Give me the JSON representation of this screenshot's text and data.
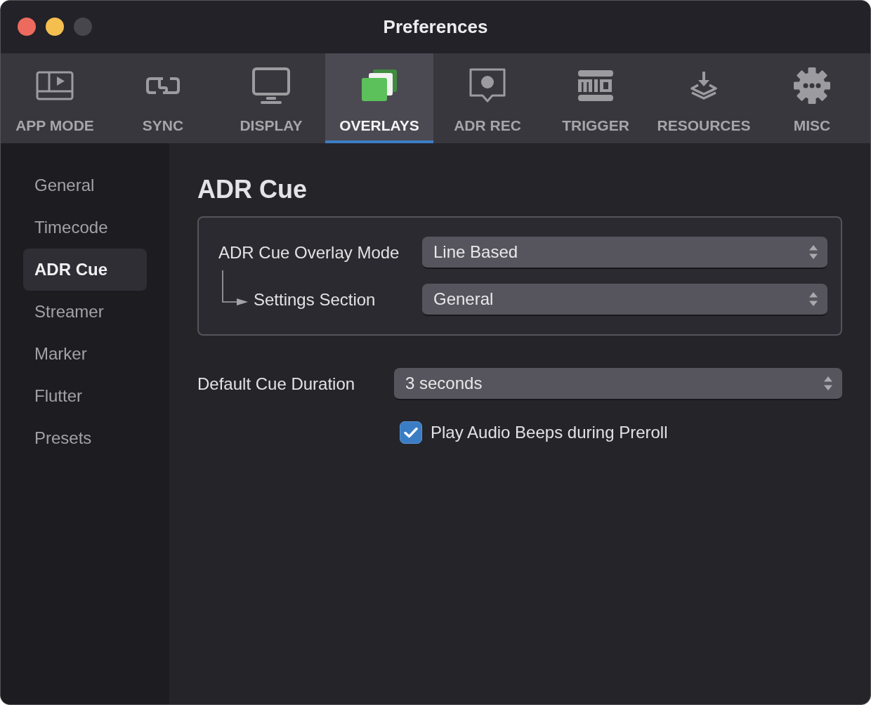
{
  "window": {
    "title": "Preferences",
    "controls": [
      {
        "kind": "close",
        "disabled": false
      },
      {
        "kind": "minimize",
        "disabled": false
      },
      {
        "kind": "zoom",
        "disabled": true
      }
    ]
  },
  "toolbar": {
    "tabs": [
      {
        "label": "APP MODE",
        "kind": "app-mode",
        "selected": false
      },
      {
        "label": "SYNC",
        "kind": "sync",
        "selected": false
      },
      {
        "label": "DISPLAY",
        "kind": "display",
        "selected": false
      },
      {
        "label": "OVERLAYS",
        "kind": "overlays",
        "selected": true
      },
      {
        "label": "ADR REC",
        "kind": "adr-rec",
        "selected": false
      },
      {
        "label": "TRIGGER",
        "kind": "trigger",
        "selected": false
      },
      {
        "label": "RESOURCES",
        "kind": "resources",
        "selected": false
      },
      {
        "label": "MISC",
        "kind": "misc",
        "selected": false
      }
    ]
  },
  "sidebar": {
    "items": [
      {
        "label": "General",
        "selected": false
      },
      {
        "label": "Timecode",
        "selected": false
      },
      {
        "label": "ADR Cue",
        "selected": true
      },
      {
        "label": "Streamer",
        "selected": false
      },
      {
        "label": "Marker",
        "selected": false
      },
      {
        "label": "Flutter",
        "selected": false
      },
      {
        "label": "Presets",
        "selected": false
      }
    ]
  },
  "content": {
    "title": "ADR Cue",
    "group": [
      {
        "label": "ADR Cue Overlay Mode",
        "value": "Line Based",
        "children": [
          {
            "label": "Settings Section",
            "value": "General"
          }
        ]
      }
    ],
    "duration": {
      "label": "Default Cue Duration",
      "value": "3 seconds"
    },
    "checkbox": {
      "label": "Play Audio Beeps during Preroll",
      "checked": true
    }
  }
}
